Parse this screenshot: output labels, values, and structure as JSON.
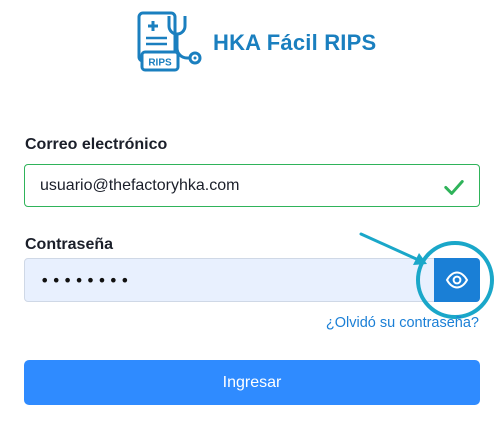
{
  "app": {
    "name": "HKA Fácil RIPS",
    "logo_badge": "RIPS",
    "brand_color": "#1a7fbf"
  },
  "form": {
    "email_label": "Correo electrónico",
    "email_value": "usuario@thefactoryhka.com",
    "email_status": "valid",
    "password_label": "Contraseña",
    "password_value": "••••••••",
    "show_password_icon": "eye-icon",
    "forgot_link": "¿Olvidó su contraseña?",
    "submit_label": "Ingresar"
  },
  "colors": {
    "accent": "#1a7fd6",
    "submit": "#2f8bff",
    "valid": "#2fb35a",
    "highlight": "#1aa7c9",
    "password_bg": "#e8f0fe"
  }
}
